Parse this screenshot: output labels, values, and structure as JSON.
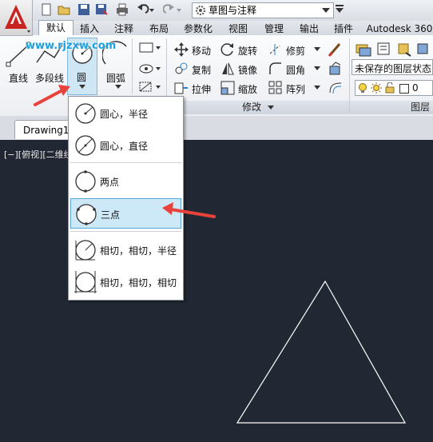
{
  "workspace": {
    "selected": "草图与注释"
  },
  "tabs": [
    "默认",
    "插入",
    "注释",
    "布局",
    "参数化",
    "视图",
    "管理",
    "输出",
    "插件",
    "Autodesk 360"
  ],
  "draw": {
    "line": "直线",
    "polyline": "多段线",
    "circle": "圆",
    "arc": "圆弧"
  },
  "modify": {
    "move": "移动",
    "rotate": "旋转",
    "trim": "修剪",
    "copy": "复制",
    "mirror": "镜像",
    "fillet": "圆角",
    "stretch": "拉伸",
    "scale": "缩放",
    "array": "阵列",
    "panel_title": "修改"
  },
  "layers": {
    "state": "未保存的图层状态",
    "current": "0",
    "panel_title": "图层"
  },
  "watermark": "www.rjzxw.com",
  "document": {
    "tab": "Drawing1",
    "viewport": "[−][俯视][二维线框]"
  },
  "circle_menu": [
    "圆心，半径",
    "圆心，直径",
    "两点",
    "三点",
    "相切，相切，半径",
    "相切，相切，相切"
  ],
  "accent_colors": {
    "app_red": "#c8231e",
    "arrow": "#e8423c",
    "selection": "#cde8f6"
  }
}
